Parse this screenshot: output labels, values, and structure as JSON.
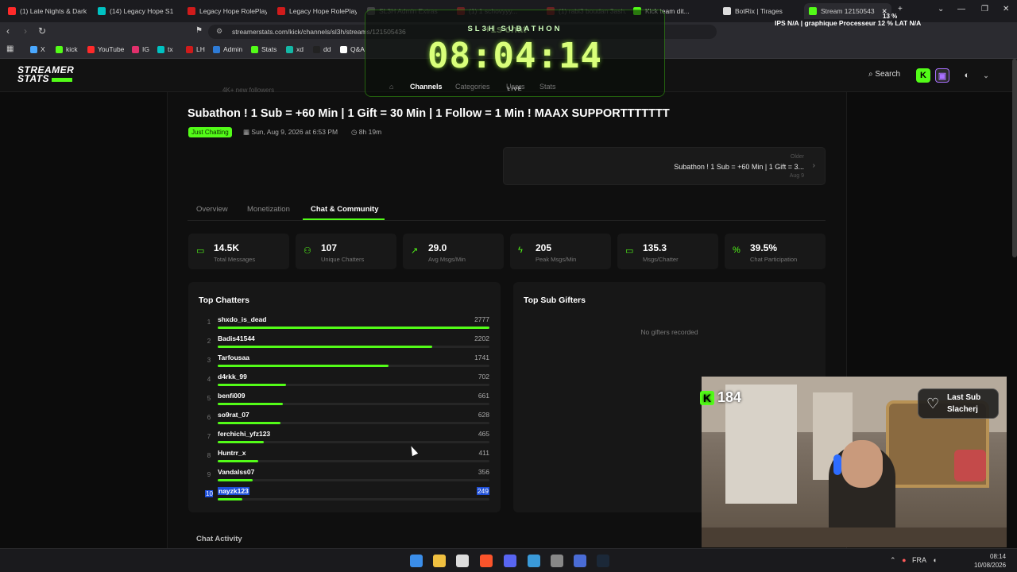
{
  "browser": {
    "tabs": [
      {
        "label": "(1) Late Nights & Dark",
        "color": "#ff2a2a"
      },
      {
        "label": "(14) Legacy Hope S1",
        "color": "#00c2c2"
      },
      {
        "label": "Legacy Hope RolePlay",
        "color": "#d01b1b"
      },
      {
        "label": "Legacy Hope RolePlay",
        "color": "#d01b1b"
      },
      {
        "label": "SL3H Admin Extras",
        "color": "#888888"
      },
      {
        "label": "(1) 1 schovyyy...",
        "color": "#ff2a2a"
      },
      {
        "label": "(1) rabi3 boudan 3ash...",
        "color": "#ff2a2a"
      },
      {
        "label": "Kick team dit...",
        "color": "#53fc18"
      },
      {
        "label": "BotRix | Tirages",
        "color": "#dddddd"
      },
      {
        "label": "Stream 12150543",
        "color": "#53fc18"
      }
    ],
    "url": "streamerstats.com/kick/channels/sl3h/streams/121505436",
    "bookmarks": [
      "X",
      "kick",
      "YouTube",
      "IG",
      "tx",
      "LH",
      "Admin",
      "Stats",
      "xd",
      "dd",
      "Q&A"
    ]
  },
  "site": {
    "logo_line1": "STREAMER",
    "logo_line2": "STATS",
    "search_label": "Search",
    "nav": [
      "Channels",
      "Categories",
      "Users",
      "Stats"
    ]
  },
  "stream": {
    "followers": "4K+ new followers",
    "title": "Subathon ! 1 Sub = +60 Min | 1 Gift = 30 Min | 1 Follow = 1 Min ! MAAX SUPPORTTTTTTT",
    "category": "Just Chatting",
    "date": "Sun, Aug 9, 2026 at 6:53 PM",
    "duration": "8h 19m",
    "older": {
      "label": "Older",
      "title": "Subathon ! 1 Sub = +60 Min | 1 Gift = 3...",
      "date": "Aug 9"
    }
  },
  "tabs": [
    "Overview",
    "Monetization",
    "Chat & Community"
  ],
  "stats": [
    {
      "value": "14.5K",
      "label": "Total Messages",
      "icon": "message-icon"
    },
    {
      "value": "107",
      "label": "Unique Chatters",
      "icon": "users-icon"
    },
    {
      "value": "29.0",
      "label": "Avg Msgs/Min",
      "icon": "trend-icon"
    },
    {
      "value": "205",
      "label": "Peak Msgs/Min",
      "icon": "bolt-icon"
    },
    {
      "value": "135.3",
      "label": "Msgs/Chatter",
      "icon": "message-icon"
    },
    {
      "value": "39.5%",
      "label": "Chat Participation",
      "icon": "percent-icon"
    }
  ],
  "top_chatters": {
    "title": "Top Chatters",
    "rows": [
      {
        "rank": "1",
        "name": "shxdo_is_dead",
        "count": "2777",
        "fill": 1.0
      },
      {
        "rank": "2",
        "name": "Badis41544",
        "count": "2202",
        "fill": 0.79
      },
      {
        "rank": "3",
        "name": "Tarfousaa",
        "count": "1741",
        "fill": 0.63
      },
      {
        "rank": "4",
        "name": "d4rkk_99",
        "count": "702",
        "fill": 0.25
      },
      {
        "rank": "5",
        "name": "benfi009",
        "count": "661",
        "fill": 0.24
      },
      {
        "rank": "6",
        "name": "so9rat_07",
        "count": "628",
        "fill": 0.23
      },
      {
        "rank": "7",
        "name": "ferchichi_yfz123",
        "count": "465",
        "fill": 0.17
      },
      {
        "rank": "8",
        "name": "Huntrr_x",
        "count": "411",
        "fill": 0.15
      },
      {
        "rank": "9",
        "name": "Vandalss07",
        "count": "356",
        "fill": 0.13
      },
      {
        "rank": "10",
        "name": "nayzk123",
        "count": "249",
        "fill": 0.09
      }
    ]
  },
  "top_gifters": {
    "title": "Top Sub Gifters",
    "empty": "No gifters recorded"
  },
  "chat_activity": "Chat Activity",
  "overlay": {
    "label": "SL3H SUBATHON",
    "timer": "08:04:14",
    "plus": "+1s chat",
    "live": "LIVE",
    "hud": "IPS N/A | graphique   Processeur 12 %   LAT N/A",
    "hud_cpu": "13 %",
    "kick_count": "184",
    "last_sub_label": "Last Sub",
    "last_sub_name": "Slacherj"
  },
  "taskbar": {
    "lang": "FRA",
    "time": "08:14",
    "date": "10/08/2026"
  },
  "colors": {
    "accent": "#53fc18",
    "bg": "#0c0c0c",
    "panel": "#171717"
  }
}
